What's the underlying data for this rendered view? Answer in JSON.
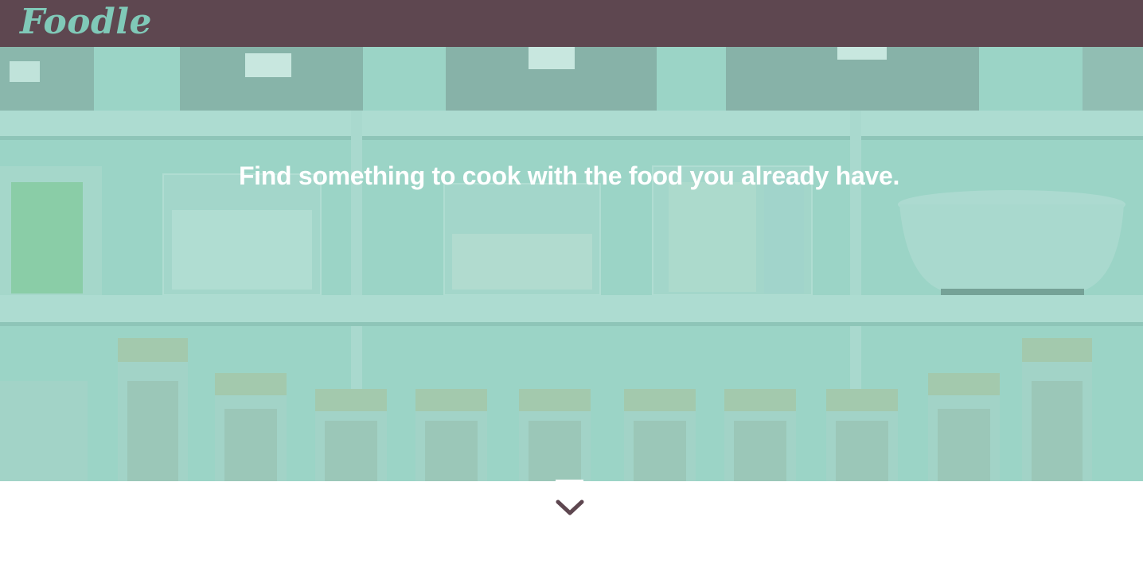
{
  "app": {
    "logo_text": "Foodle"
  },
  "hero": {
    "headline": "Find something to cook with the food you already have.",
    "background_image": "pantry-shelves-with-glass-jars"
  },
  "scroll": {
    "icon": "chevron-down-icon"
  },
  "colors": {
    "navbar": "#5e4750",
    "logo": "#80c9b8",
    "hero_tint": "#80c9b8",
    "chevron": "#5e4750"
  }
}
